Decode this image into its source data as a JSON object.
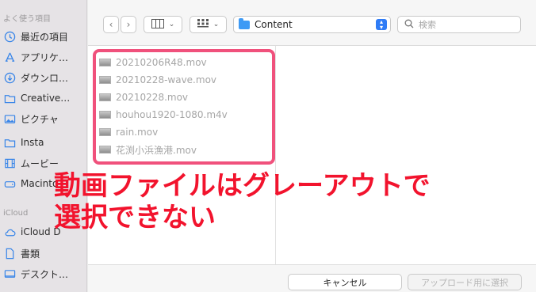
{
  "sidebar": {
    "favorites_header": "よく使う項目",
    "items": [
      {
        "label": "最近の項目",
        "icon": "clock-icon"
      },
      {
        "label": "アプリケ…",
        "icon": "applications-icon"
      },
      {
        "label": "ダウンロ…",
        "icon": "download-icon"
      },
      {
        "label": "Creative…",
        "icon": "folder-icon"
      },
      {
        "label": "ピクチャ",
        "icon": "pictures-icon"
      },
      {
        "label": "Insta",
        "icon": "folder-icon"
      },
      {
        "label": "ムービー",
        "icon": "film-icon"
      },
      {
        "label": "Macinto",
        "icon": "drive-icon"
      }
    ],
    "icloud_header": "iCloud",
    "icloud_items": [
      {
        "label": "iCloud D",
        "icon": "cloud-icon"
      },
      {
        "label": "書類",
        "icon": "document-icon"
      },
      {
        "label": "デスクト…",
        "icon": "desktop-icon"
      }
    ]
  },
  "toolbar": {
    "back_icon": "chevron-left-icon",
    "forward_icon": "chevron-right-icon",
    "view_icon": "columns-view-icon",
    "group_icon": "grid-icon",
    "location": "Content",
    "search_placeholder": "検索"
  },
  "files": [
    {
      "name": "20210206R48.mov"
    },
    {
      "name": "20210228-wave.mov"
    },
    {
      "name": "20210228.mov"
    },
    {
      "name": "houhou1920-1080.m4v"
    },
    {
      "name": "rain.mov"
    },
    {
      "name": "花渕小浜漁港.mov"
    }
  ],
  "annotation": {
    "line1": "動画ファイルはグレーアウトで",
    "line2": "選択できない",
    "color": "#f2132d",
    "box_color": "#f0517c"
  },
  "buttons": {
    "cancel": "キャンセル",
    "upload": "アップロード用に選択"
  }
}
